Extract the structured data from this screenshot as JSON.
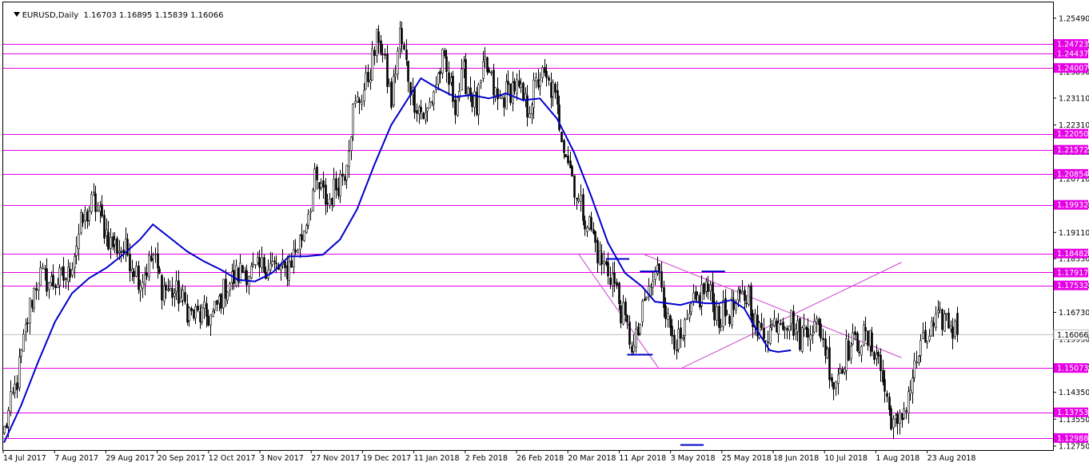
{
  "header": {
    "symbol_timeframe": "EURUSD,Daily",
    "ohlc": "1.16703 1.16895 1.15839 1.16066"
  },
  "chart_data": {
    "type": "candlestick",
    "symbol": "EURUSD",
    "timeframe": "Daily",
    "ohlc_last": {
      "open": 1.16703,
      "high": 1.16895,
      "low": 1.15839,
      "close": 1.16066
    },
    "ylim": [
      1.1263,
      1.2596
    ],
    "y_ticks": [
      "1.25490",
      "1.24670",
      "1.23890",
      "1.23110",
      "1.22310",
      "1.21510",
      "1.20710",
      "1.19910",
      "1.19110",
      "1.18330",
      "1.17530",
      "1.16730",
      "1.15930",
      "1.15130",
      "1.14350",
      "1.13550",
      "1.12750"
    ],
    "x_ticks": [
      "14 Jul 2017",
      "7 Aug 2017",
      "29 Aug 2017",
      "20 Sep 2017",
      "12 Oct 2017",
      "3 Nov 2017",
      "27 Nov 2017",
      "19 Dec 2017",
      "11 Jan 2018",
      "2 Feb 2018",
      "26 Feb 2018",
      "20 Mar 2018",
      "11 Apr 2018",
      "3 May 2018",
      "25 May 2018",
      "18 Jun 2018",
      "10 Jul 2018",
      "1 Aug 2018",
      "23 Aug 2018"
    ],
    "current_price": "1.16066",
    "current_price_value": 1.16066,
    "horizontal_levels": [
      {
        "value": 1.24723,
        "label": "1.24723"
      },
      {
        "value": 1.24437,
        "label": "1.24437"
      },
      {
        "value": 1.24007,
        "label": "1.24007"
      },
      {
        "value": 1.2205,
        "label": "1.22050"
      },
      {
        "value": 1.21572,
        "label": "1.21572"
      },
      {
        "value": 1.20854,
        "label": "1.20854"
      },
      {
        "value": 1.19932,
        "label": "1.19932"
      },
      {
        "value": 1.18482,
        "label": "1.18482"
      },
      {
        "value": 1.17917,
        "label": "1.17917"
      },
      {
        "value": 1.17532,
        "label": "1.17532"
      },
      {
        "value": 1.15073,
        "label": "1.15073"
      },
      {
        "value": 1.13753,
        "label": "1.13753"
      },
      {
        "value": 1.12988,
        "label": "1.12988"
      }
    ],
    "ma_line": [
      [
        0,
        1.1285
      ],
      [
        8,
        1.1395
      ],
      [
        16,
        1.1525
      ],
      [
        24,
        1.1645
      ],
      [
        32,
        1.173
      ],
      [
        40,
        1.1775
      ],
      [
        48,
        1.1805
      ],
      [
        56,
        1.1845
      ],
      [
        64,
        1.189
      ],
      [
        70,
        1.1935
      ],
      [
        78,
        1.1895
      ],
      [
        86,
        1.1855
      ],
      [
        94,
        1.1825
      ],
      [
        102,
        1.18
      ],
      [
        110,
        1.177
      ],
      [
        118,
        1.1765
      ],
      [
        126,
        1.179
      ],
      [
        134,
        1.184
      ],
      [
        142,
        1.184
      ],
      [
        150,
        1.1845
      ],
      [
        158,
        1.189
      ],
      [
        166,
        1.198
      ],
      [
        174,
        1.211
      ],
      [
        182,
        1.223
      ],
      [
        190,
        1.231
      ],
      [
        196,
        1.237
      ],
      [
        204,
        1.234
      ],
      [
        212,
        1.2315
      ],
      [
        220,
        1.232
      ],
      [
        228,
        1.231
      ],
      [
        236,
        1.2325
      ],
      [
        244,
        1.2305
      ],
      [
        252,
        1.231
      ],
      [
        260,
        1.225
      ],
      [
        268,
        1.215
      ],
      [
        276,
        1.202
      ],
      [
        284,
        1.188
      ],
      [
        292,
        1.179
      ],
      [
        300,
        1.175
      ],
      [
        306,
        1.1705
      ],
      [
        312,
        1.17
      ],
      [
        318,
        1.1695
      ],
      [
        324,
        1.1705
      ],
      [
        330,
        1.17
      ],
      [
        336,
        1.17
      ],
      [
        342,
        1.171
      ],
      [
        348,
        1.1685
      ],
      [
        354,
        1.162
      ],
      [
        360,
        1.156
      ],
      [
        364,
        1.1555
      ],
      [
        370,
        1.156
      ]
    ],
    "segments": [
      {
        "x1": 270,
        "y1": 1.1848,
        "x2": 308,
        "y2": 1.1505,
        "note": "falling wedge line"
      },
      {
        "x1": 318,
        "y1": 1.1505,
        "x2": 422,
        "y2": 1.1822,
        "note": "rising trend line"
      },
      {
        "x1": 300,
        "y1": 1.1848,
        "x2": 422,
        "y2": 1.1538,
        "note": "falling trend line"
      }
    ],
    "marker_lines": [
      {
        "x1": 283,
        "x2": 294,
        "y": 1.1832
      },
      {
        "x1": 299,
        "x2": 308,
        "y": 1.1795
      },
      {
        "x1": 293,
        "x2": 305,
        "y": 1.1547
      },
      {
        "x1": 328,
        "x2": 339,
        "y": 1.1795
      },
      {
        "x1": 318,
        "x2": 329,
        "y": 1.1278
      }
    ],
    "colors": {
      "candle": "#000000",
      "candle_up_fill": "#ffffff",
      "candle_down_fill": "#000000",
      "ma": "#0000cc",
      "level": "#e600e6",
      "level_label_bg": "#e600e6",
      "level_label_text": "#ffffff",
      "trend": "#cc44cc",
      "current_price_line": "#c0c0c0"
    },
    "anchors": [
      [
        0,
        1.132
      ],
      [
        6,
        1.147
      ],
      [
        12,
        1.169
      ],
      [
        16,
        1.1785
      ],
      [
        22,
        1.176
      ],
      [
        30,
        1.178
      ],
      [
        36,
        1.193
      ],
      [
        42,
        1.2005
      ],
      [
        50,
        1.188
      ],
      [
        58,
        1.185
      ],
      [
        64,
        1.177
      ],
      [
        70,
        1.184
      ],
      [
        74,
        1.175
      ],
      [
        82,
        1.1725
      ],
      [
        88,
        1.1665
      ],
      [
        98,
        1.166
      ],
      [
        104,
        1.175
      ],
      [
        112,
        1.18
      ],
      [
        118,
        1.179
      ],
      [
        124,
        1.182
      ],
      [
        132,
        1.179
      ],
      [
        140,
        1.19
      ],
      [
        146,
        1.206
      ],
      [
        152,
        1.2
      ],
      [
        160,
        1.21
      ],
      [
        164,
        1.227
      ],
      [
        170,
        1.235
      ],
      [
        176,
        1.25
      ],
      [
        182,
        1.23
      ],
      [
        186,
        1.25
      ],
      [
        192,
        1.232
      ],
      [
        198,
        1.225
      ],
      [
        206,
        1.242
      ],
      [
        212,
        1.23
      ],
      [
        216,
        1.238
      ],
      [
        222,
        1.228
      ],
      [
        226,
        1.241
      ],
      [
        232,
        1.23
      ],
      [
        240,
        1.235
      ],
      [
        246,
        1.228
      ],
      [
        252,
        1.238
      ],
      [
        258,
        1.233
      ],
      [
        262,
        1.221
      ],
      [
        270,
        1.2
      ],
      [
        276,
        1.192
      ],
      [
        280,
        1.183
      ],
      [
        286,
        1.178
      ],
      [
        290,
        1.168
      ],
      [
        296,
        1.156
      ],
      [
        302,
        1.172
      ],
      [
        308,
        1.181
      ],
      [
        312,
        1.164
      ],
      [
        318,
        1.157
      ],
      [
        324,
        1.169
      ],
      [
        330,
        1.175
      ],
      [
        336,
        1.166
      ],
      [
        342,
        1.168
      ],
      [
        350,
        1.173
      ],
      [
        354,
        1.161
      ],
      [
        360,
        1.162
      ],
      [
        364,
        1.166
      ],
      [
        370,
        1.165
      ],
      [
        374,
        1.16
      ],
      [
        378,
        1.164
      ],
      [
        384,
        1.162
      ],
      [
        390,
        1.146
      ],
      [
        396,
        1.156
      ],
      [
        404,
        1.16
      ],
      [
        410,
        1.156
      ],
      [
        416,
        1.138
      ],
      [
        420,
        1.132
      ],
      [
        424,
        1.141
      ],
      [
        430,
        1.155
      ],
      [
        436,
        1.162
      ],
      [
        442,
        1.166
      ],
      [
        448,
        1.161
      ]
    ]
  }
}
